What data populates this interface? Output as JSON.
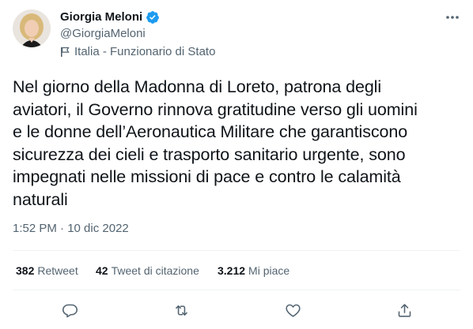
{
  "author": {
    "name": "Giorgia Meloni",
    "handle": "@GiorgiaMeloni",
    "affiliation": "Italia - Funzionario di Stato",
    "verified": true
  },
  "tweet": {
    "text": "Nel giorno della Madonna di Loreto, patrona degli\naviatori, il Governo rinnova gratitudine verso gli uomini\ne le donne dell’Aeronautica Militare che garantiscono\nsicurezza dei cieli e trasporto sanitario urgente, sono\nimpegnati nelle missioni di pace e contro le calamità\nnaturali",
    "timestamp": "1:52 PM · 10 dic 2022"
  },
  "stats": {
    "retweets": {
      "count": "382",
      "label": "Retweet"
    },
    "quotes": {
      "count": "42",
      "label": "Tweet di citazione"
    },
    "likes": {
      "count": "3.212",
      "label": "Mi piace"
    }
  },
  "actions": [
    "reply-icon",
    "retweet-icon",
    "like-icon",
    "share-icon"
  ],
  "colors": {
    "text": "#0f1419",
    "secondary": "#536471",
    "verified": "#1d9bf0",
    "divider": "#eff3f4"
  }
}
